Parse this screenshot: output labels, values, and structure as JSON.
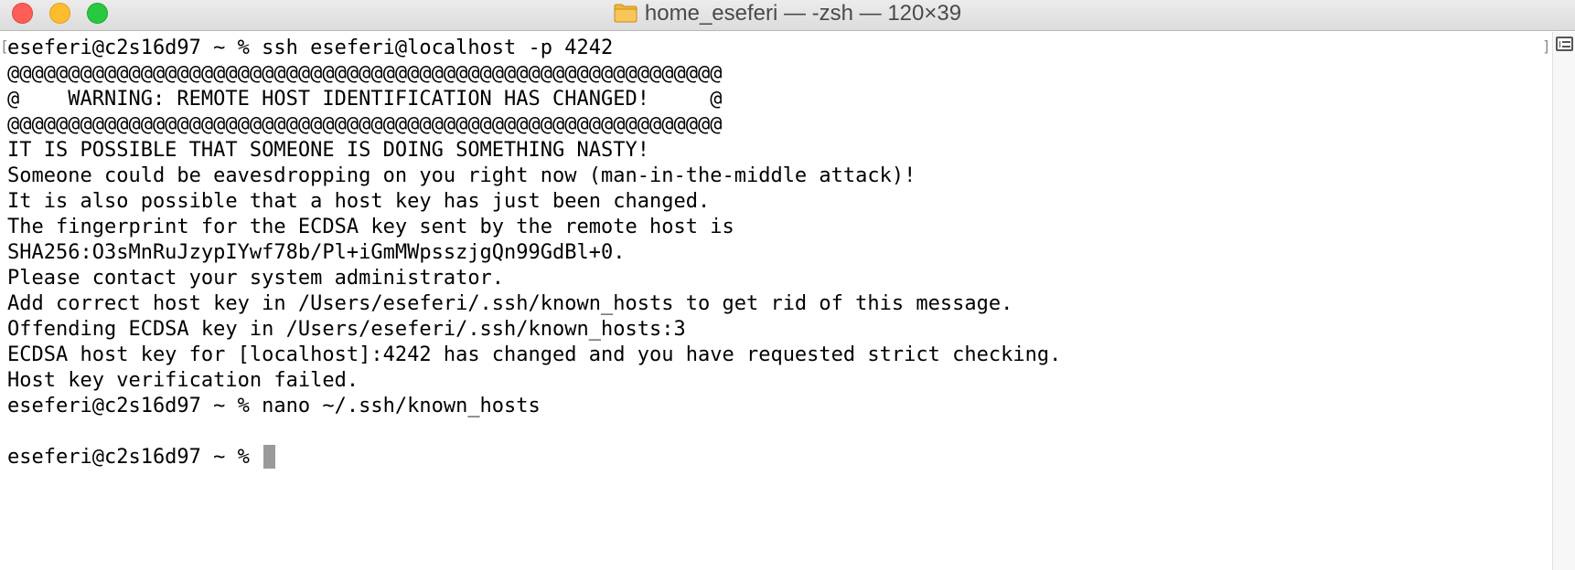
{
  "window": {
    "title": "home_eseferi — -zsh — 120×39",
    "icon": "folder-icon",
    "colors": {
      "close": "#fd5f57",
      "minimize": "#febc2e",
      "zoom": "#28c840"
    }
  },
  "terminal": {
    "lines": [
      "eseferi@c2s16d97 ~ % ssh eseferi@localhost -p 4242",
      "@@@@@@@@@@@@@@@@@@@@@@@@@@@@@@@@@@@@@@@@@@@@@@@@@@@@@@@@@@@",
      "@    WARNING: REMOTE HOST IDENTIFICATION HAS CHANGED!     @",
      "@@@@@@@@@@@@@@@@@@@@@@@@@@@@@@@@@@@@@@@@@@@@@@@@@@@@@@@@@@@",
      "IT IS POSSIBLE THAT SOMEONE IS DOING SOMETHING NASTY!",
      "Someone could be eavesdropping on you right now (man-in-the-middle attack)!",
      "It is also possible that a host key has just been changed.",
      "The fingerprint for the ECDSA key sent by the remote host is",
      "SHA256:O3sMnRuJzypIYwf78b/Pl+iGmMWpsszjgQn99GdBl+0.",
      "Please contact your system administrator.",
      "Add correct host key in /Users/eseferi/.ssh/known_hosts to get rid of this message.",
      "Offending ECDSA key in /Users/eseferi/.ssh/known_hosts:3",
      "ECDSA host key for [localhost]:4242 has changed and you have requested strict checking.",
      "Host key verification failed.",
      "eseferi@c2s16d97 ~ % nano ~/.ssh/known_hosts",
      "",
      "eseferi@c2s16d97 ~ % "
    ]
  }
}
